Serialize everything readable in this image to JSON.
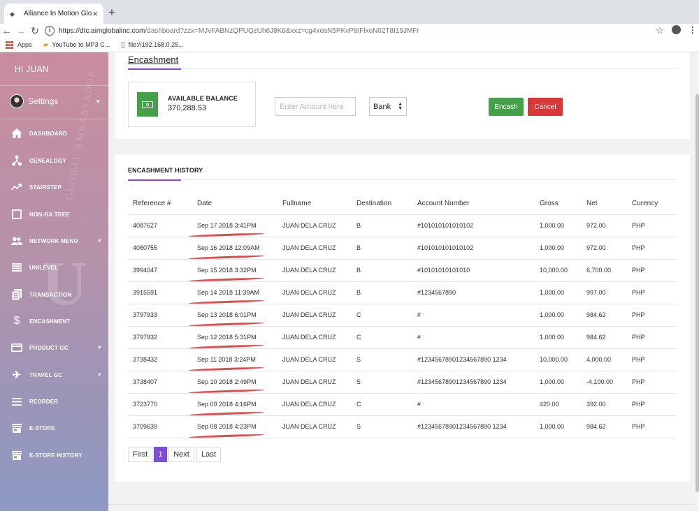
{
  "browser": {
    "tab_title": "Alliance In Motion Global Inc.",
    "url_host": "https://dtc.aimglobalinc.com",
    "url_path": "/dashboard?zzx=MJvFABNzQPUQzUh6J8K6&xxz=cg4xosN5PKvP8IFlxoN02T8I19JMFr",
    "bookmarks": [
      {
        "label": "Apps",
        "icon": "apps-grid-icon"
      },
      {
        "label": "YouTube to MP3 C...",
        "icon": "folder-icon"
      },
      {
        "label": "file://192.168.0.25...",
        "icon": "file-icon"
      }
    ]
  },
  "sidebar": {
    "greeting": "HI  JUAN",
    "settings_label": "Settings",
    "items": [
      {
        "label": "DASHBOARD",
        "icon": "home-icon"
      },
      {
        "label": "GENEALOGY",
        "icon": "network-icon"
      },
      {
        "label": "STAIRSTEP",
        "icon": "trend-icon"
      },
      {
        "label": "NON-GA TREE",
        "icon": "square-icon"
      },
      {
        "label": "NETWORK MENU",
        "icon": "group-icon"
      },
      {
        "label": "UNILEVEL",
        "icon": "list-icon"
      },
      {
        "label": "TRANSACTION",
        "icon": "document-icon"
      },
      {
        "label": "ENCASHMENT",
        "icon": "dollar-icon"
      },
      {
        "label": "PRODUCT GC",
        "icon": "card-icon"
      },
      {
        "label": "TRAVEL GC",
        "icon": "plane-icon"
      },
      {
        "label": "REORDER",
        "icon": "menu-icon"
      },
      {
        "label": "E-STORE",
        "icon": "store-icon"
      },
      {
        "label": "E-STORE HISTORY",
        "icon": "store-icon"
      }
    ]
  },
  "encashment": {
    "title": "Encashment",
    "balance_label": "AVAILABLE BALANCE",
    "balance_value": "370,288.53",
    "amount_placeholder": "Enter Amount here",
    "destination_selected": "Bank",
    "encash_label": "Encash",
    "cancel_label": "Cancel"
  },
  "history": {
    "title": "ENCASHMENT HISTORY",
    "columns": [
      "Reference #",
      "Date",
      "Fullname",
      "Destination",
      "Account Number",
      "Gross",
      "Net",
      "Curency"
    ],
    "rows": [
      [
        "4087627",
        "Sep 17 2018 3:41PM",
        "JUAN DELA CRUZ",
        "B",
        "#101010101010102",
        "1,000.00",
        "972.00",
        "PHP"
      ],
      [
        "4080755",
        "Sep 16 2018 12:09AM",
        "JUAN DELA CRUZ",
        "B",
        "#101010101010102",
        "1,000.00",
        "972.00",
        "PHP"
      ],
      [
        "3994047",
        "Sep 15 2018 3:32PM",
        "JUAN DELA CRUZ",
        "B",
        "#10101010101010",
        "10,000.00",
        "6,700.00",
        "PHP"
      ],
      [
        "3915591",
        "Sep 14 2018 11:39AM",
        "JUAN DELA CRUZ",
        "B",
        "#1234567890",
        "1,000.00",
        "997.00",
        "PHP"
      ],
      [
        "3797933",
        "Sep 13 2018 6:01PM",
        "JUAN DELA CRUZ",
        "C",
        "#",
        "1,000.00",
        "984.62",
        "PHP"
      ],
      [
        "3797932",
        "Sep 12 2018 5:31PM",
        "JUAN DELA CRUZ",
        "C",
        "#",
        "1,000.00",
        "984.62",
        "PHP"
      ],
      [
        "3738432",
        "Sep 11 2018 3:24PM",
        "JUAN DELA CRUZ",
        "S",
        "#12345678901234567890 1234",
        "10,000.00",
        "4,000.00",
        "PHP"
      ],
      [
        "3738407",
        "Sep 10 2018 2:49PM",
        "JUAN DELA CRUZ",
        "S",
        "#12345678901234567890 1234",
        "1,000.00",
        "-4,100.00",
        "PHP"
      ],
      [
        "3723770",
        "Sep 09 2018 4:16PM",
        "JUAN DELA CRUZ",
        "C",
        "#",
        "420.00",
        "392.00",
        "PHP"
      ],
      [
        "3709639",
        "Sep 08 2018 4:23PM",
        "JUAN DELA CRUZ",
        "S",
        "#12345678901234567890 1234",
        "1,000.00",
        "984.62",
        "PHP"
      ]
    ]
  },
  "pagination": {
    "first": "First",
    "current": "1",
    "next": "Next",
    "last": "Last"
  },
  "colors": {
    "accent": "#8e44d6",
    "success": "#45a049",
    "danger": "#d9383a",
    "active_page": "#7b4fd6"
  }
}
